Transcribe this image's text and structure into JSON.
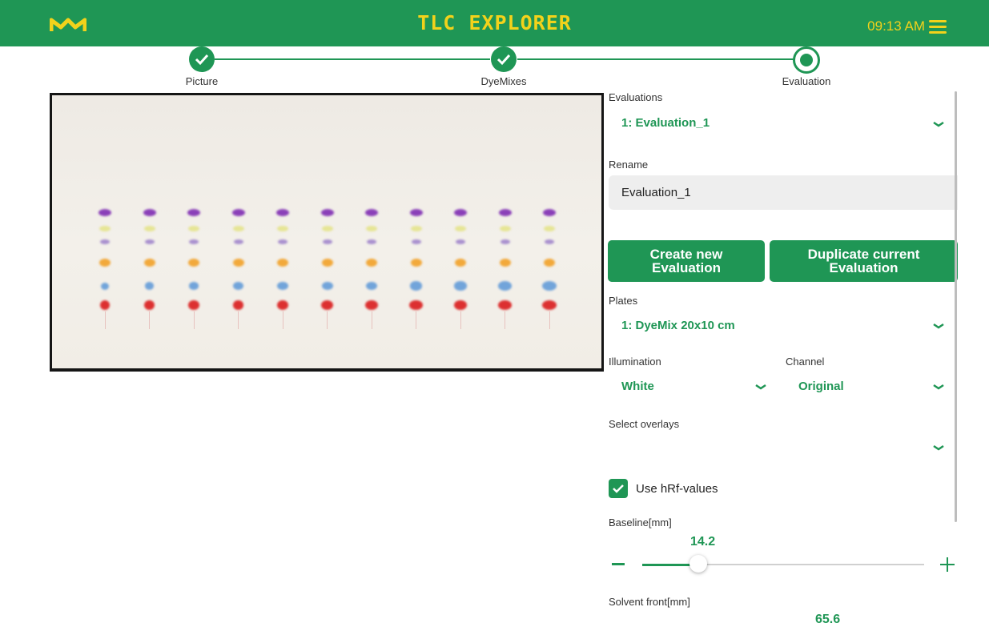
{
  "header": {
    "title": "TLC EXPLORER",
    "time": "09:13 AM",
    "colors": {
      "bar": "#1f9655",
      "accent": "#f2d21b"
    }
  },
  "stepper": {
    "steps": [
      {
        "label": "Picture",
        "state": "done"
      },
      {
        "label": "DyeMixes",
        "state": "done"
      },
      {
        "label": "Evaluation",
        "state": "current"
      }
    ]
  },
  "panel": {
    "evaluations_label": "Evaluations",
    "evaluation_selected": "1: Evaluation_1",
    "rename_label": "Rename",
    "rename_value": "Evaluation_1",
    "create_button": "Create new\nEvaluation",
    "duplicate_button": "Duplicate current\nEvaluation",
    "plates_label": "Plates",
    "plate_selected": "1: DyeMix 20x10 cm",
    "illumination_label": "Illumination",
    "illumination_selected": "White",
    "channel_label": "Channel",
    "channel_selected": "Original",
    "overlays_label": "Select overlays",
    "overlays_selected": "",
    "hrf_label": "Use hRf-values",
    "hrf_checked": true,
    "baseline_label": "Baseline[mm]",
    "baseline_value": "14.2",
    "baseline_fraction": 0.2,
    "solvent_label": "Solvent front[mm]",
    "solvent_value": "65.6"
  }
}
